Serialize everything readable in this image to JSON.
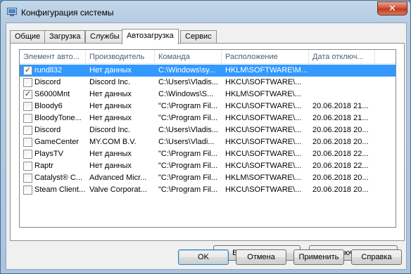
{
  "window": {
    "title": "Конфигурация системы",
    "close_glyph": "✕"
  },
  "tabs": [
    {
      "label": "Общие"
    },
    {
      "label": "Загрузка"
    },
    {
      "label": "Службы"
    },
    {
      "label": "Автозагрузка",
      "active": true
    },
    {
      "label": "Сервис"
    }
  ],
  "columns": [
    "Элемент авто...",
    "Производитель",
    "Команда",
    "Расположение",
    "Дата отключ..."
  ],
  "rows": [
    {
      "checked": true,
      "selected": true,
      "item": "rundll32",
      "maker": "Нет данных",
      "command": "C:\\Windows\\sy...",
      "location": "HKLM\\SOFTWARE\\M...",
      "date": ""
    },
    {
      "checked": false,
      "selected": false,
      "item": "Discord",
      "maker": "Discord Inc.",
      "command": "C:\\Users\\Vladis...",
      "location": "HKCU\\SOFTWARE\\...",
      "date": ""
    },
    {
      "checked": true,
      "selected": false,
      "item": "S6000Mnt",
      "maker": "Нет данных",
      "command": "C:\\Windows\\S...",
      "location": "HKLM\\SOFTWARE\\...",
      "date": ""
    },
    {
      "checked": false,
      "selected": false,
      "item": "Bloody6",
      "maker": "Нет данных",
      "command": "\"C:\\Program Fil...",
      "location": "HKCU\\SOFTWARE\\...",
      "date": "20.06.2018 21..."
    },
    {
      "checked": false,
      "selected": false,
      "item": "BloodyTone...",
      "maker": "Нет данных",
      "command": "\"C:\\Program Fil...",
      "location": "HKCU\\SOFTWARE\\...",
      "date": "20.06.2018 21..."
    },
    {
      "checked": false,
      "selected": false,
      "item": "Discord",
      "maker": "Discord Inc.",
      "command": "C:\\Users\\Vladis...",
      "location": "HKCU\\SOFTWARE\\...",
      "date": "20.06.2018 20..."
    },
    {
      "checked": false,
      "selected": false,
      "item": "GameCenter",
      "maker": "MY.COM B.V.",
      "command": "C:\\Users\\Vladi...",
      "location": "HKCU\\SOFTWARE\\...",
      "date": "20.06.2018 20..."
    },
    {
      "checked": false,
      "selected": false,
      "item": "PlaysTV",
      "maker": "Нет данных",
      "command": "\"C:\\Program Fil...",
      "location": "HKCU\\SOFTWARE\\...",
      "date": "20.06.2018 22..."
    },
    {
      "checked": false,
      "selected": false,
      "item": "Raptr",
      "maker": "Нет данных",
      "command": "\"C:\\Program Fil...",
      "location": "HKCU\\SOFTWARE\\...",
      "date": "20.06.2018 22..."
    },
    {
      "checked": false,
      "selected": false,
      "item": "Catalyst® C...",
      "maker": "Advanced Micr...",
      "command": "\"C:\\Program Fil...",
      "location": "HKLM\\SOFTWARE\\...",
      "date": "20.06.2018 20..."
    },
    {
      "checked": false,
      "selected": false,
      "item": "Steam Client...",
      "maker": "Valve Corporat...",
      "command": "\"C:\\Program Fil...",
      "location": "HKCU\\SOFTWARE\\...",
      "date": "20.06.2018 20..."
    }
  ],
  "panel_buttons": {
    "enable_all": "Включить все",
    "disable_all": "Отключить все"
  },
  "dialog_buttons": {
    "ok": "OK",
    "cancel": "Отмена",
    "apply": "Применить",
    "help": "Справка"
  },
  "check_glyph": "✓",
  "colors": {
    "selection": "#3399ff",
    "header_text": "#4c607a"
  }
}
